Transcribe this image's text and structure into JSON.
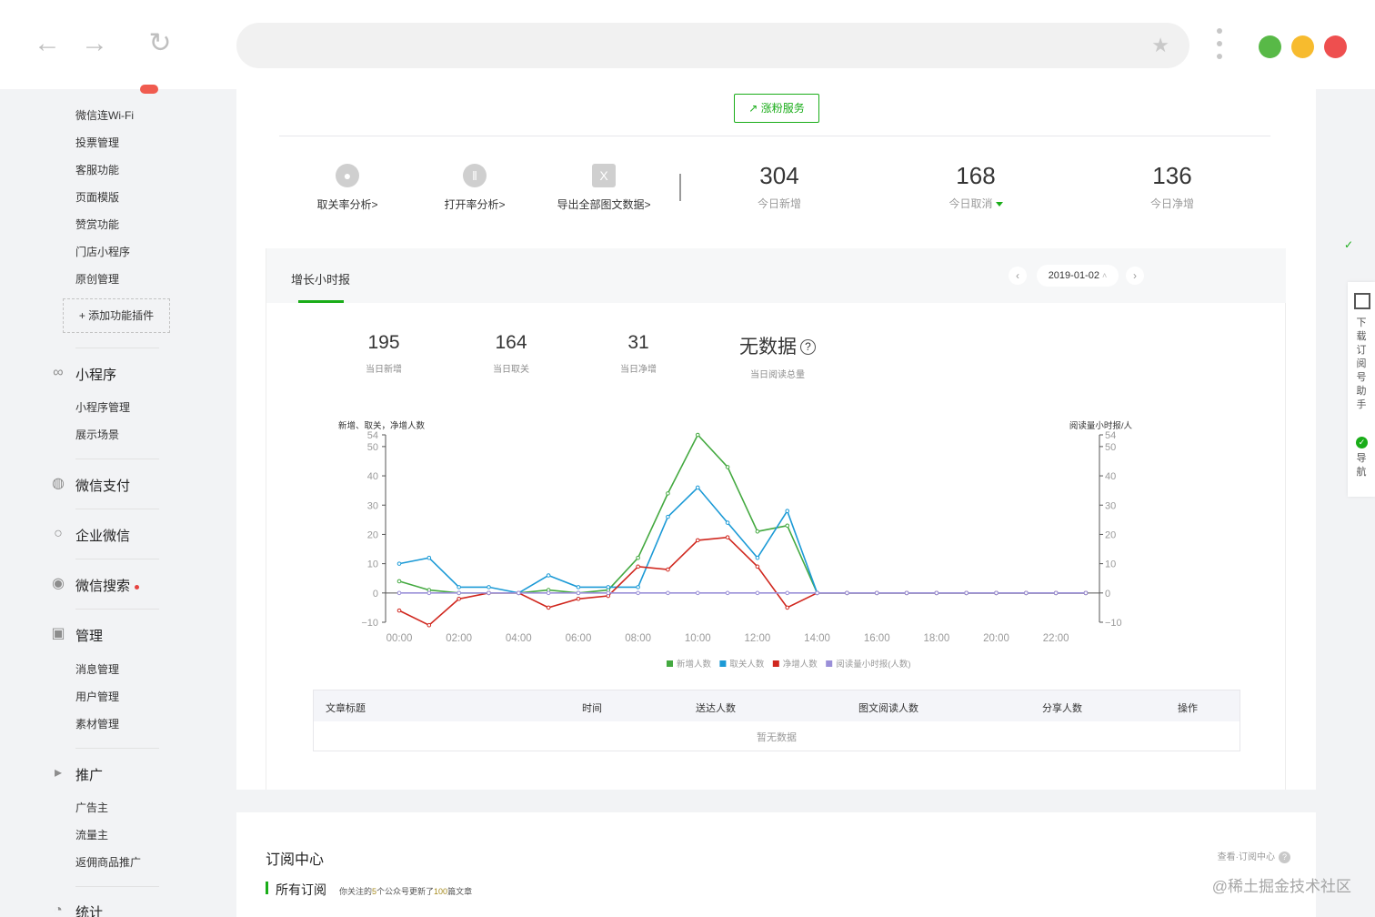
{
  "sidebar": {
    "top_items": [
      "微信连Wi-Fi",
      "投票管理",
      "客服功能",
      "页面模版",
      "赞赏功能",
      "门店小程序",
      "原创管理"
    ],
    "add_plugin": "添加功能插件",
    "mini_program": {
      "label": "小程序",
      "items": [
        "小程序管理",
        "展示场景"
      ]
    },
    "wechat_pay": "微信支付",
    "work_wechat": "企业微信",
    "wechat_search": "微信搜索",
    "manage": {
      "label": "管理",
      "items": [
        "消息管理",
        "用户管理",
        "素材管理"
      ]
    },
    "promote": {
      "label": "推广",
      "items": [
        "广告主",
        "流量主",
        "返佣商品推广"
      ]
    },
    "stats": "统计"
  },
  "top": {
    "grow_button": "涨粉服务",
    "tools": [
      "取关率分析>",
      "打开率分析>",
      "导出全部图文数据>"
    ],
    "stats": [
      {
        "value": "304",
        "label": "今日新增"
      },
      {
        "value": "168",
        "label": "今日取消"
      },
      {
        "value": "136",
        "label": "今日净增"
      }
    ]
  },
  "card": {
    "title": "增长小时报",
    "date": "2019-01-02",
    "kpis": [
      {
        "value": "195",
        "label": "当日新增"
      },
      {
        "value": "164",
        "label": "当日取关"
      },
      {
        "value": "31",
        "label": "当日净增"
      },
      {
        "value": "无数据",
        "label": "当日阅读总量"
      }
    ]
  },
  "chart_data": {
    "type": "line",
    "title": "",
    "ylabel_left": "新增、取关，净增人数",
    "ylabel_right": "阅读量小时报/人",
    "ylim": [
      -10,
      54
    ],
    "yticks": [
      -10,
      0,
      10,
      20,
      30,
      40,
      50,
      54
    ],
    "x_ticks": [
      "00:00",
      "02:00",
      "04:00",
      "06:00",
      "08:00",
      "10:00",
      "12:00",
      "14:00",
      "16:00",
      "18:00",
      "20:00",
      "22:00"
    ],
    "x": [
      "00:00",
      "01:00",
      "02:00",
      "03:00",
      "04:00",
      "05:00",
      "06:00",
      "07:00",
      "08:00",
      "09:00",
      "10:00",
      "11:00",
      "12:00",
      "13:00",
      "14:00",
      "15:00",
      "16:00",
      "17:00",
      "18:00",
      "19:00",
      "20:00",
      "21:00",
      "22:00",
      "23:00"
    ],
    "series": [
      {
        "name": "新增人数",
        "color": "#44a940",
        "values": [
          4,
          1,
          0,
          0,
          0,
          1,
          0,
          1,
          12,
          34,
          54,
          43,
          21,
          23,
          0,
          0,
          0,
          0,
          0,
          0,
          0,
          0,
          0,
          0
        ]
      },
      {
        "name": "取关人数",
        "color": "#1c9ad6",
        "values": [
          10,
          12,
          2,
          2,
          0,
          6,
          2,
          2,
          2,
          26,
          36,
          24,
          12,
          28,
          0,
          0,
          0,
          0,
          0,
          0,
          0,
          0,
          0,
          0
        ]
      },
      {
        "name": "净增人数",
        "color": "#d0271e",
        "values": [
          -6,
          -11,
          -2,
          0,
          0,
          -5,
          -2,
          -1,
          9,
          8,
          18,
          19,
          9,
          -5,
          0,
          0,
          0,
          0,
          0,
          0,
          0,
          0,
          0,
          0
        ]
      },
      {
        "name": "阅读量小时报(人数)",
        "color": "#9a8fd8",
        "values": [
          0,
          0,
          0,
          0,
          0,
          0,
          0,
          0,
          0,
          0,
          0,
          0,
          0,
          0,
          0,
          0,
          0,
          0,
          0,
          0,
          0,
          0,
          0,
          0
        ]
      }
    ],
    "legend_position": "bottom"
  },
  "table": {
    "headers": [
      "文章标题",
      "时间",
      "送达人数",
      "图文阅读人数",
      "分享人数",
      "操作"
    ],
    "empty": "暂无数据"
  },
  "subscribe": {
    "title": "订阅中心",
    "link": "查看·订阅中心",
    "all": "所有订阅",
    "note_a": "你关注的",
    "note_b": "5",
    "note_c": "个公众号更新了",
    "note_d": "100",
    "note_e": "篇文章"
  },
  "float": {
    "download": "下载订阅号助手",
    "nav": "导航"
  },
  "watermark": "@稀土掘金技术社区"
}
